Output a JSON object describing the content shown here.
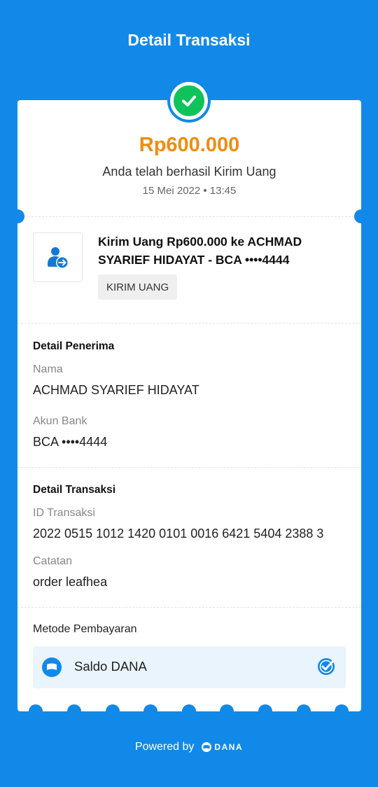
{
  "header": {
    "title": "Detail Transaksi"
  },
  "summary": {
    "amount": "Rp600.000",
    "status_text": "Anda telah berhasil Kirim Uang",
    "datetime": "15 Mei 2022 • 13:45"
  },
  "transaction": {
    "title": "Kirim Uang Rp600.000 ke ACHMAD SYARIEF HIDAYAT - BCA ••••4444",
    "category_badge": "KIRIM UANG",
    "icon": "send-money-icon"
  },
  "recipient": {
    "section_title": "Detail Penerima",
    "name_label": "Nama",
    "name_value": "ACHMAD SYARIEF HIDAYAT",
    "bank_label": "Akun Bank",
    "bank_value": "BCA ••••4444"
  },
  "details": {
    "section_title": "Detail Transaksi",
    "id_label": "ID Transaksi",
    "id_value": "2022 0515 1012 1420 0101 0016 6421 5404 2388 3",
    "note_label": "Catatan",
    "note_value": "order leafhea"
  },
  "payment": {
    "label": "Metode Pembayaran",
    "method": "Saldo DANA"
  },
  "footer": {
    "powered_by": "Powered by",
    "brand": "DANA"
  },
  "colors": {
    "primary_blue": "#1189E8",
    "amount_orange": "#F08C10",
    "success_green": "#10C25A"
  }
}
